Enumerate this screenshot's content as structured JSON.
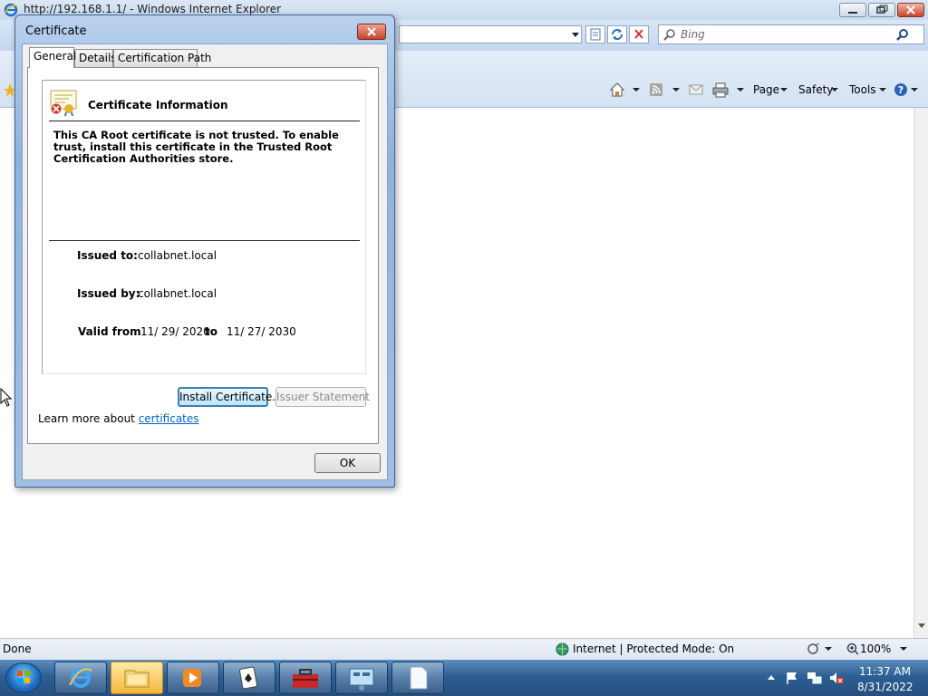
{
  "browser": {
    "title": "http://192.168.1.1/ - Windows Internet Explorer",
    "search_placeholder": "Bing",
    "commands": {
      "page": "Page",
      "safety": "Safety",
      "tools": "Tools"
    },
    "status": {
      "left": "Done",
      "zone": "Internet | Protected Mode: On",
      "zoom": "100%"
    }
  },
  "dialog": {
    "title": "Certificate",
    "tabs": [
      "General",
      "Details",
      "Certification Path"
    ],
    "info_heading": "Certificate Information",
    "warning": "This CA Root certificate is not trusted. To enable trust, install this certificate in the Trusted Root Certification Authorities store.",
    "issued_to_label": "Issued to:",
    "issued_to_value": "collabnet.local",
    "issued_by_label": "Issued by:",
    "issued_by_value": "collabnet.local",
    "valid_from_label": "Valid from",
    "valid_from_value": "11/ 29/ 2020",
    "valid_to_label": "to",
    "valid_to_value": "11/ 27/ 2030",
    "install_button": "Install Certificate...",
    "issuer_button": "Issuer Statement",
    "learn_more_prefix": "Learn more about",
    "learn_more_link": "certificates",
    "ok_button": "OK"
  },
  "taskbar": {
    "time": "11:37 AM",
    "date": "8/31/2022"
  }
}
